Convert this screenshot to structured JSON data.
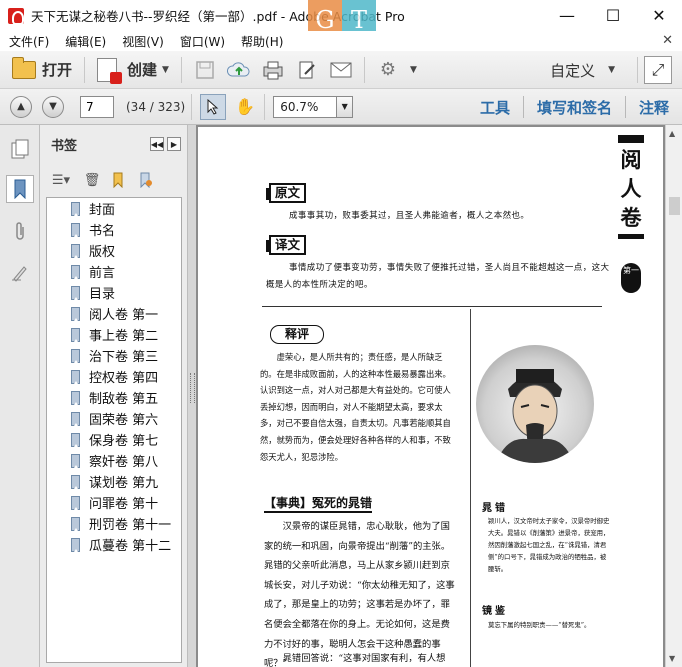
{
  "window": {
    "title": "天下无谋之秘卷八书--罗织经（第一部）.pdf - Adobe Acrobat Pro",
    "watermark_letters": [
      "G",
      "T"
    ],
    "minimize": "—",
    "maximize": "☐",
    "close": "✕"
  },
  "menu": {
    "items": [
      "文件(F)",
      "编辑(E)",
      "视图(V)",
      "窗口(W)",
      "帮助(H)"
    ],
    "close_doc": "✕"
  },
  "toolbar": {
    "open_label": "打开",
    "create_label": "创建",
    "customize_label": "自定义",
    "caret": "▼"
  },
  "nav": {
    "up_arrow": "▲",
    "down_arrow": "▼",
    "page_value": "7",
    "page_count": "(34 / 323)",
    "zoom_value": "60.7%",
    "panels": [
      "工具",
      "填写和签名",
      "注释"
    ]
  },
  "bookmarks": {
    "title": "书签",
    "items": [
      "封面",
      "书名",
      "版权",
      "前言",
      "目录",
      "阅人卷 第一",
      "事上卷 第二",
      "治下卷 第三",
      "控权卷 第四",
      "制敌卷 第五",
      "固荣卷 第六",
      "保身卷 第七",
      "察奸卷 第八",
      "谋划卷 第九",
      "问罪卷 第十",
      "刑罚卷 第十一",
      "瓜蔓卷 第十二"
    ]
  },
  "page": {
    "volume_title": "阅人卷",
    "chapter_tag": "第一",
    "yuanwen_label": "原文",
    "yuanwen_text": "成事事其功，败事委其过，且圣人弗能逾者，概人之本然也。",
    "yiwen_label": "译文",
    "yiwen_text": "事情成功了便事变功劳，事情失败了便推托过错，圣人尚且不能超越这一点，这大概是人的本性所决定的吧。",
    "pingshi_label": "释评",
    "pingshi_text": "虚荣心，是人所共有的；责任感，是人所缺乏的。在是非成败面前，人的这种本性最易暴露出来。认识到这一点，对人对己都是大有益处的。它可使人丢掉幻想，因而明白，对人不能期望太高，要求太多，对己不要自信太强，自责太切。凡事若能顺其自然，就势而为，便会处理好各种各样的人和事，不致怨天尤人，犯忌涉险。",
    "shidian_label": "【事典】冤死的晁错",
    "shidian_text": "汉景帝的谋臣晁错，忠心耿耿，他为了国家的统一和巩固，向景帝提出“削藩”的主张。晁错的父亲听此消息，马上从家乡颍川赶到京城长安，对儿子劝说：“你太幼稚无知了，这事成了，那是皇上的功劳；这事若是办坏了，罪名便会全都落在你的身上。无论如何，这是费力不讨好的事，聪明人怎会干这种愚蠢的事呢？”",
    "shidian_next": "晁错回答说：“这事对国家有利，有人想",
    "side1_name": "晁错",
    "side1_desc": "颍川人，汉文帝时太子家令，汉景帝时御史大夫。晁错以《削藩策》进景帝，获宠用，然因削藩激起七国之乱，在“诛晁错，清君侧”的口号下，晁错成为政治的牺牲品，被腰斩。",
    "side2_name": "镜鉴",
    "side2_desc": "莫忘下属的特别职责——“替死鬼”。"
  }
}
